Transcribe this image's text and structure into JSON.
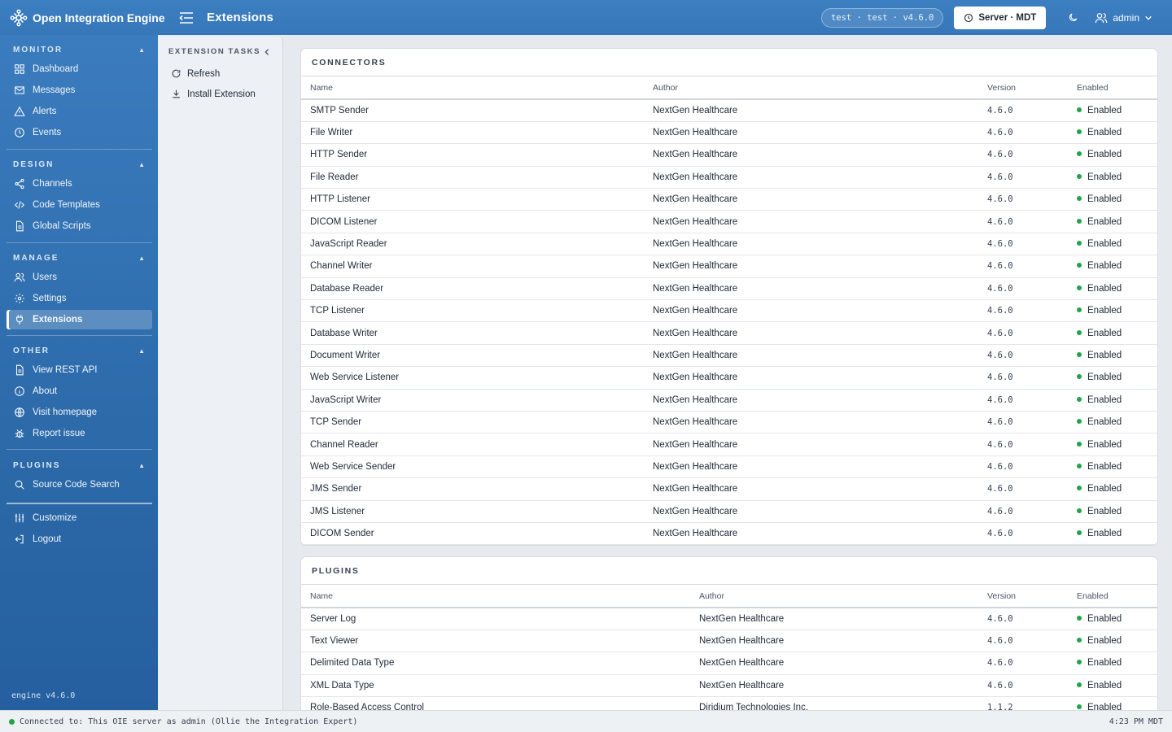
{
  "app": {
    "name": "Open Integration Engine",
    "page_title": "Extensions"
  },
  "header": {
    "env": "test · test · v4.6.0",
    "server_label": "Server · MDT",
    "user": "admin"
  },
  "sidebar": {
    "sections": [
      {
        "title": "MONITOR",
        "items": [
          {
            "label": "Dashboard",
            "icon": "dashboard-icon"
          },
          {
            "label": "Messages",
            "icon": "mail-icon"
          },
          {
            "label": "Alerts",
            "icon": "alert-icon"
          },
          {
            "label": "Events",
            "icon": "clock-icon"
          }
        ]
      },
      {
        "title": "DESIGN",
        "items": [
          {
            "label": "Channels",
            "icon": "share-icon"
          },
          {
            "label": "Code Templates",
            "icon": "code-icon"
          },
          {
            "label": "Global Scripts",
            "icon": "file-icon"
          }
        ]
      },
      {
        "title": "MANAGE",
        "items": [
          {
            "label": "Users",
            "icon": "users-icon"
          },
          {
            "label": "Settings",
            "icon": "gear-icon"
          },
          {
            "label": "Extensions",
            "icon": "plug-icon",
            "active": true
          }
        ]
      },
      {
        "title": "OTHER",
        "items": [
          {
            "label": "View REST API",
            "icon": "file-icon"
          },
          {
            "label": "About",
            "icon": "info-icon"
          },
          {
            "label": "Visit homepage",
            "icon": "globe-icon"
          },
          {
            "label": "Report issue",
            "icon": "bug-icon"
          }
        ]
      },
      {
        "title": "PLUGINS",
        "items": [
          {
            "label": "Source Code Search",
            "icon": "search-icon"
          }
        ]
      }
    ],
    "footer_items": [
      {
        "label": "Customize",
        "icon": "sliders-icon"
      },
      {
        "label": "Logout",
        "icon": "logout-icon"
      }
    ],
    "engine_version": "engine v4.6.0"
  },
  "tasks": {
    "title": "EXTENSION TASKS",
    "items": [
      {
        "label": "Refresh",
        "icon": "refresh-icon"
      },
      {
        "label": "Install Extension",
        "icon": "download-icon"
      }
    ]
  },
  "connectors": {
    "title": "CONNECTORS",
    "columns": [
      "Name",
      "Author",
      "Version",
      "Enabled"
    ],
    "rows": [
      [
        "SMTP Sender",
        "NextGen Healthcare",
        "4.6.0",
        "Enabled"
      ],
      [
        "File Writer",
        "NextGen Healthcare",
        "4.6.0",
        "Enabled"
      ],
      [
        "HTTP Sender",
        "NextGen Healthcare",
        "4.6.0",
        "Enabled"
      ],
      [
        "File Reader",
        "NextGen Healthcare",
        "4.6.0",
        "Enabled"
      ],
      [
        "HTTP Listener",
        "NextGen Healthcare",
        "4.6.0",
        "Enabled"
      ],
      [
        "DICOM Listener",
        "NextGen Healthcare",
        "4.6.0",
        "Enabled"
      ],
      [
        "JavaScript Reader",
        "NextGen Healthcare",
        "4.6.0",
        "Enabled"
      ],
      [
        "Channel Writer",
        "NextGen Healthcare",
        "4.6.0",
        "Enabled"
      ],
      [
        "Database Reader",
        "NextGen Healthcare",
        "4.6.0",
        "Enabled"
      ],
      [
        "TCP Listener",
        "NextGen Healthcare",
        "4.6.0",
        "Enabled"
      ],
      [
        "Database Writer",
        "NextGen Healthcare",
        "4.6.0",
        "Enabled"
      ],
      [
        "Document Writer",
        "NextGen Healthcare",
        "4.6.0",
        "Enabled"
      ],
      [
        "Web Service Listener",
        "NextGen Healthcare",
        "4.6.0",
        "Enabled"
      ],
      [
        "JavaScript Writer",
        "NextGen Healthcare",
        "4.6.0",
        "Enabled"
      ],
      [
        "TCP Sender",
        "NextGen Healthcare",
        "4.6.0",
        "Enabled"
      ],
      [
        "Channel Reader",
        "NextGen Healthcare",
        "4.6.0",
        "Enabled"
      ],
      [
        "Web Service Sender",
        "NextGen Healthcare",
        "4.6.0",
        "Enabled"
      ],
      [
        "JMS Sender",
        "NextGen Healthcare",
        "4.6.0",
        "Enabled"
      ],
      [
        "JMS Listener",
        "NextGen Healthcare",
        "4.6.0",
        "Enabled"
      ],
      [
        "DICOM Sender",
        "NextGen Healthcare",
        "4.6.0",
        "Enabled"
      ]
    ]
  },
  "plugins": {
    "title": "PLUGINS",
    "columns": [
      "Name",
      "Author",
      "Version",
      "Enabled"
    ],
    "rows": [
      [
        "Server Log",
        "NextGen Healthcare",
        "4.6.0",
        "Enabled"
      ],
      [
        "Text Viewer",
        "NextGen Healthcare",
        "4.6.0",
        "Enabled"
      ],
      [
        "Delimited Data Type",
        "NextGen Healthcare",
        "4.6.0",
        "Enabled"
      ],
      [
        "XML Data Type",
        "NextGen Healthcare",
        "4.6.0",
        "Enabled"
      ],
      [
        "Role-Based Access Control",
        "Diridium Technologies Inc.",
        "1.1.2",
        "Enabled"
      ]
    ]
  },
  "status": {
    "connection": "Connected to: This OIE server as admin (Ollie the Integration Expert)",
    "time": "4:23 PM MDT"
  },
  "colors": {
    "header": "#3c7fc1",
    "sidebar": "#2d6bab",
    "enabled_dot": "#22a34a"
  }
}
